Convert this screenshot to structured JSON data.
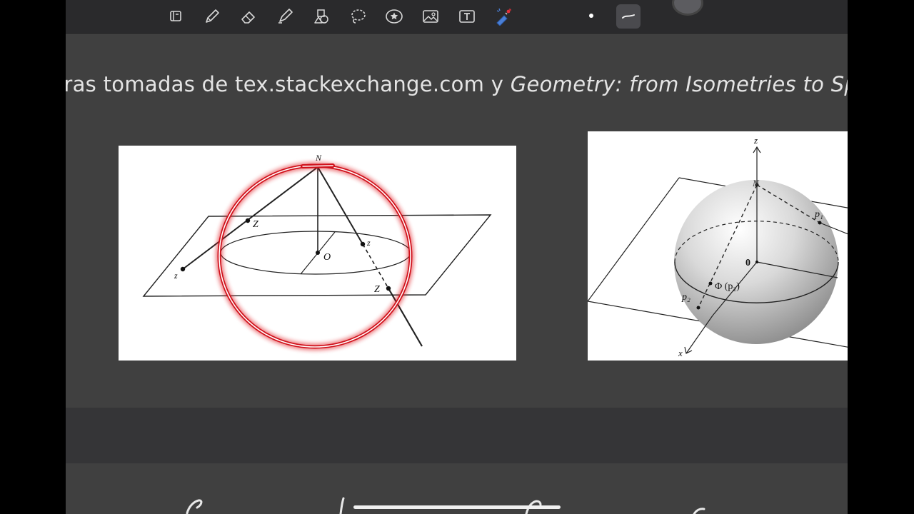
{
  "toolbar": {
    "tools": [
      {
        "name": "bookmark-icon",
        "active": false
      },
      {
        "name": "pen-icon",
        "active": false
      },
      {
        "name": "eraser-icon",
        "active": false
      },
      {
        "name": "highlighter-icon",
        "active": false
      },
      {
        "name": "shapes-icon",
        "active": false
      },
      {
        "name": "lasso-icon",
        "active": false
      },
      {
        "name": "sticker-icon",
        "active": false
      },
      {
        "name": "image-icon",
        "active": false
      },
      {
        "name": "text-box-icon",
        "active": false
      },
      {
        "name": "laser-pointer-icon",
        "active": false
      },
      {
        "name": "stroke-style-icon",
        "active": true
      }
    ]
  },
  "slide": {
    "caption_prefix": "guras tomadas de tex.stackexchange.com y ",
    "caption_italic": "Geometry: from Isometries to Sp"
  },
  "figure_left": {
    "labels": {
      "n": "N",
      "o": "O",
      "z_upper_left": "Z",
      "z_lower_left": "z",
      "z_right_small": "z",
      "z_right_large": "Z"
    }
  },
  "figure_right": {
    "labels": {
      "z_axis": "z",
      "n": "N",
      "p1": "p₁",
      "origin": "0",
      "phi": "Φ (p₂)",
      "p2": "p₂",
      "x_axis": "x"
    }
  },
  "colors": {
    "annotation": "#d0101a",
    "toolbar": "#2a2a2c",
    "slide": "#404040"
  }
}
